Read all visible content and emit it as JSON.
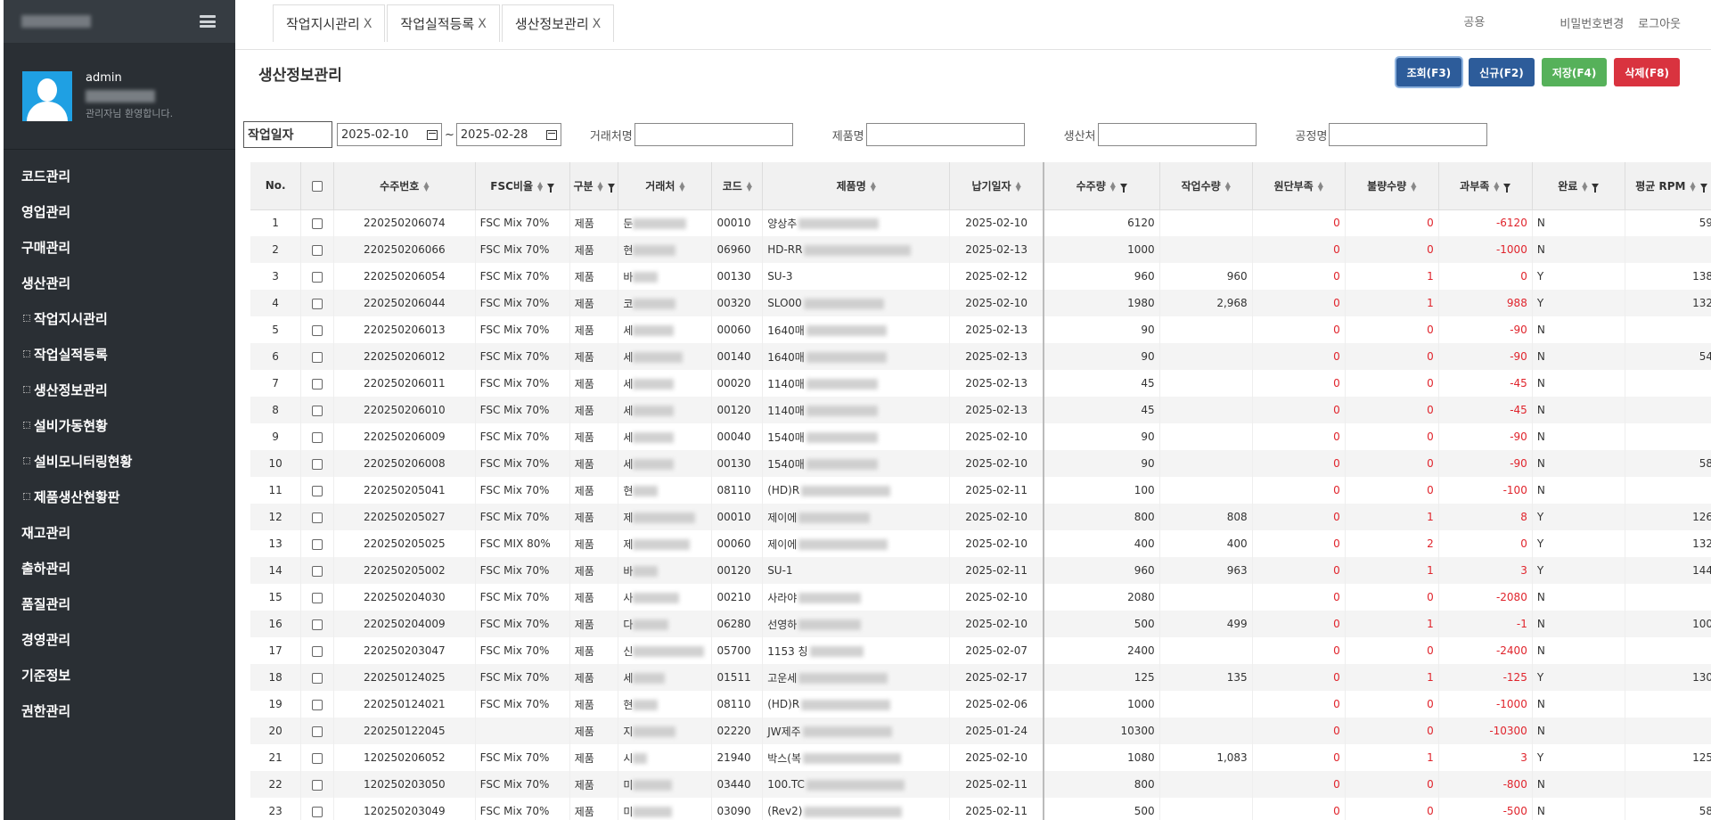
{
  "sidebar": {
    "user": "admin",
    "welcome": "관리자님 환영합니다.",
    "menu": [
      {
        "label": "코드관리",
        "sub": false
      },
      {
        "label": "영업관리",
        "sub": false
      },
      {
        "label": "구매관리",
        "sub": false
      },
      {
        "label": "생산관리",
        "sub": false
      },
      {
        "label": "작업지시관리",
        "sub": true
      },
      {
        "label": "작업실적등록",
        "sub": true
      },
      {
        "label": "생산정보관리",
        "sub": true
      },
      {
        "label": "설비가동현황",
        "sub": true
      },
      {
        "label": "설비모니터링현황",
        "sub": true
      },
      {
        "label": "제품생산현황판",
        "sub": true
      },
      {
        "label": "재고관리",
        "sub": false
      },
      {
        "label": "출하관리",
        "sub": false
      },
      {
        "label": "품질관리",
        "sub": false
      },
      {
        "label": "경영관리",
        "sub": false
      },
      {
        "label": "기준정보",
        "sub": false
      },
      {
        "label": "권한관리",
        "sub": false
      }
    ]
  },
  "tabs": [
    {
      "label": "작업지시관리",
      "close": "X"
    },
    {
      "label": "작업실적등록",
      "close": "X"
    },
    {
      "label": "생산정보관리",
      "close": "X"
    }
  ],
  "topbar": {
    "placeholder": "공용",
    "change_password": "비밀번호변경",
    "logout": "로그아웃"
  },
  "page": {
    "title": "생산정보관리"
  },
  "buttons": {
    "query": "조회(F3)",
    "new": "신규(F2)",
    "save": "저장(F4)",
    "delete": "삭제(F8)"
  },
  "search": {
    "date_label": "작업일자",
    "date_from": "2025-02-10",
    "tilde": "~",
    "date_to": "2025-02-28",
    "customer_label": "거래처명",
    "product_label": "제품명",
    "producer_label": "생산처",
    "process_label": "공정명"
  },
  "columns": [
    "No.",
    "",
    "수주번호",
    "FSC비율",
    "구분",
    "거래처",
    "코드",
    "제품명",
    "납기일자",
    "수주량",
    "작업수량",
    "원단부족",
    "불량수량",
    "과부족",
    "완료",
    "평균 RPM"
  ],
  "rows": [
    {
      "no": "1",
      "order": "220250206074",
      "fsc": "FSC Mix 70%",
      "type": "제품",
      "cust": "둔",
      "code": "00010",
      "prod": "양상추",
      "due": "2025-02-10",
      "qty": "6120",
      "work": "",
      "short": "0",
      "defect": "0",
      "diff": "-6120",
      "done": "N",
      "rpm": "59"
    },
    {
      "no": "2",
      "order": "220250206066",
      "fsc": "FSC Mix 70%",
      "type": "제품",
      "cust": "현",
      "code": "06960",
      "prod": "HD-RR",
      "due": "2025-02-13",
      "qty": "1000",
      "work": "",
      "short": "0",
      "defect": "0",
      "diff": "-1000",
      "done": "N",
      "rpm": ""
    },
    {
      "no": "3",
      "order": "220250206054",
      "fsc": "FSC Mix 70%",
      "type": "제품",
      "cust": "바",
      "code": "00130",
      "prod": "SU-3",
      "due": "2025-02-12",
      "qty": "960",
      "work": "960",
      "short": "0",
      "defect": "1",
      "diff": "0",
      "done": "Y",
      "rpm": "138"
    },
    {
      "no": "4",
      "order": "220250206044",
      "fsc": "FSC Mix 70%",
      "type": "제품",
      "cust": "코",
      "code": "00320",
      "prod": "SLO00",
      "due": "2025-02-10",
      "qty": "1980",
      "work": "2,968",
      "short": "0",
      "defect": "1",
      "diff": "988",
      "done": "Y",
      "rpm": "132"
    },
    {
      "no": "5",
      "order": "220250206013",
      "fsc": "FSC Mix 70%",
      "type": "제품",
      "cust": "세",
      "code": "00060",
      "prod": "1640매",
      "due": "2025-02-13",
      "qty": "90",
      "work": "",
      "short": "0",
      "defect": "0",
      "diff": "-90",
      "done": "N",
      "rpm": ""
    },
    {
      "no": "6",
      "order": "220250206012",
      "fsc": "FSC Mix 70%",
      "type": "제품",
      "cust": "세",
      "code": "00140",
      "prod": "1640매",
      "due": "2025-02-13",
      "qty": "90",
      "work": "",
      "short": "0",
      "defect": "0",
      "diff": "-90",
      "done": "N",
      "rpm": "54"
    },
    {
      "no": "7",
      "order": "220250206011",
      "fsc": "FSC Mix 70%",
      "type": "제품",
      "cust": "세",
      "code": "00020",
      "prod": "1140매",
      "due": "2025-02-13",
      "qty": "45",
      "work": "",
      "short": "0",
      "defect": "0",
      "diff": "-45",
      "done": "N",
      "rpm": ""
    },
    {
      "no": "8",
      "order": "220250206010",
      "fsc": "FSC Mix 70%",
      "type": "제품",
      "cust": "세",
      "code": "00120",
      "prod": "1140매",
      "due": "2025-02-13",
      "qty": "45",
      "work": "",
      "short": "0",
      "defect": "0",
      "diff": "-45",
      "done": "N",
      "rpm": ""
    },
    {
      "no": "9",
      "order": "220250206009",
      "fsc": "FSC Mix 70%",
      "type": "제품",
      "cust": "세",
      "code": "00040",
      "prod": "1540매",
      "due": "2025-02-10",
      "qty": "90",
      "work": "",
      "short": "0",
      "defect": "0",
      "diff": "-90",
      "done": "N",
      "rpm": ""
    },
    {
      "no": "10",
      "order": "220250206008",
      "fsc": "FSC Mix 70%",
      "type": "제품",
      "cust": "세",
      "code": "00130",
      "prod": "1540매",
      "due": "2025-02-10",
      "qty": "90",
      "work": "",
      "short": "0",
      "defect": "0",
      "diff": "-90",
      "done": "N",
      "rpm": "58"
    },
    {
      "no": "11",
      "order": "220250205041",
      "fsc": "FSC Mix 70%",
      "type": "제품",
      "cust": "현",
      "code": "08110",
      "prod": "(HD)R",
      "due": "2025-02-11",
      "qty": "100",
      "work": "",
      "short": "0",
      "defect": "0",
      "diff": "-100",
      "done": "N",
      "rpm": ""
    },
    {
      "no": "12",
      "order": "220250205027",
      "fsc": "FSC Mix 70%",
      "type": "제품",
      "cust": "제",
      "code": "00010",
      "prod": "제이에",
      "due": "2025-02-10",
      "qty": "800",
      "work": "808",
      "short": "0",
      "defect": "1",
      "diff": "8",
      "done": "Y",
      "rpm": "126"
    },
    {
      "no": "13",
      "order": "220250205025",
      "fsc": "FSC MIX 80%",
      "type": "제품",
      "cust": "제",
      "code": "00060",
      "prod": "제이에",
      "due": "2025-02-10",
      "qty": "400",
      "work": "400",
      "short": "0",
      "defect": "2",
      "diff": "0",
      "done": "Y",
      "rpm": "132"
    },
    {
      "no": "14",
      "order": "220250205002",
      "fsc": "FSC Mix 70%",
      "type": "제품",
      "cust": "바",
      "code": "00120",
      "prod": "SU-1",
      "due": "2025-02-11",
      "qty": "960",
      "work": "963",
      "short": "0",
      "defect": "1",
      "diff": "3",
      "done": "Y",
      "rpm": "144"
    },
    {
      "no": "15",
      "order": "220250204030",
      "fsc": "FSC Mix 70%",
      "type": "제품",
      "cust": "사",
      "code": "00210",
      "prod": "사라야",
      "due": "2025-02-10",
      "qty": "2080",
      "work": "",
      "short": "0",
      "defect": "0",
      "diff": "-2080",
      "done": "N",
      "rpm": ""
    },
    {
      "no": "16",
      "order": "220250204009",
      "fsc": "FSC Mix 70%",
      "type": "제품",
      "cust": "다",
      "code": "06280",
      "prod": "선영하",
      "due": "2025-02-10",
      "qty": "500",
      "work": "499",
      "short": "0",
      "defect": "1",
      "diff": "-1",
      "done": "N",
      "rpm": "100"
    },
    {
      "no": "17",
      "order": "220250203047",
      "fsc": "FSC Mix 70%",
      "type": "제품",
      "cust": "신",
      "code": "05700",
      "prod": "1153 칭",
      "due": "2025-02-07",
      "qty": "2400",
      "work": "",
      "short": "0",
      "defect": "0",
      "diff": "-2400",
      "done": "N",
      "rpm": ""
    },
    {
      "no": "18",
      "order": "220250124025",
      "fsc": "FSC Mix 70%",
      "type": "제품",
      "cust": "세",
      "code": "01511",
      "prod": "고운세",
      "due": "2025-02-17",
      "qty": "125",
      "work": "135",
      "short": "0",
      "defect": "1",
      "diff": "-125",
      "done": "Y",
      "rpm": "130"
    },
    {
      "no": "19",
      "order": "220250124021",
      "fsc": "FSC Mix 70%",
      "type": "제품",
      "cust": "현",
      "code": "08110",
      "prod": "(HD)R",
      "due": "2025-02-06",
      "qty": "1000",
      "work": "",
      "short": "0",
      "defect": "0",
      "diff": "-1000",
      "done": "N",
      "rpm": ""
    },
    {
      "no": "20",
      "order": "220250122045",
      "fsc": "",
      "type": "제품",
      "cust": "지",
      "code": "02220",
      "prod": "JW제주",
      "due": "2025-01-24",
      "qty": "10300",
      "work": "",
      "short": "0",
      "defect": "0",
      "diff": "-10300",
      "done": "N",
      "rpm": ""
    },
    {
      "no": "21",
      "order": "120250206052",
      "fsc": "FSC Mix 70%",
      "type": "제품",
      "cust": "시",
      "code": "21940",
      "prod": "박스(복",
      "due": "2025-02-10",
      "qty": "1080",
      "work": "1,083",
      "short": "0",
      "defect": "1",
      "diff": "3",
      "done": "Y",
      "rpm": "125"
    },
    {
      "no": "22",
      "order": "120250203050",
      "fsc": "FSC Mix 70%",
      "type": "제품",
      "cust": "미",
      "code": "03440",
      "prod": "100.TC",
      "due": "2025-02-11",
      "qty": "800",
      "work": "",
      "short": "0",
      "defect": "0",
      "diff": "-800",
      "done": "N",
      "rpm": ""
    },
    {
      "no": "23",
      "order": "120250203049",
      "fsc": "FSC Mix 70%",
      "type": "제품",
      "cust": "미",
      "code": "03090",
      "prod": "(Rev2)",
      "due": "2025-02-11",
      "qty": "500",
      "work": "",
      "short": "0",
      "defect": "0",
      "diff": "-500",
      "done": "N",
      "rpm": "58"
    }
  ]
}
